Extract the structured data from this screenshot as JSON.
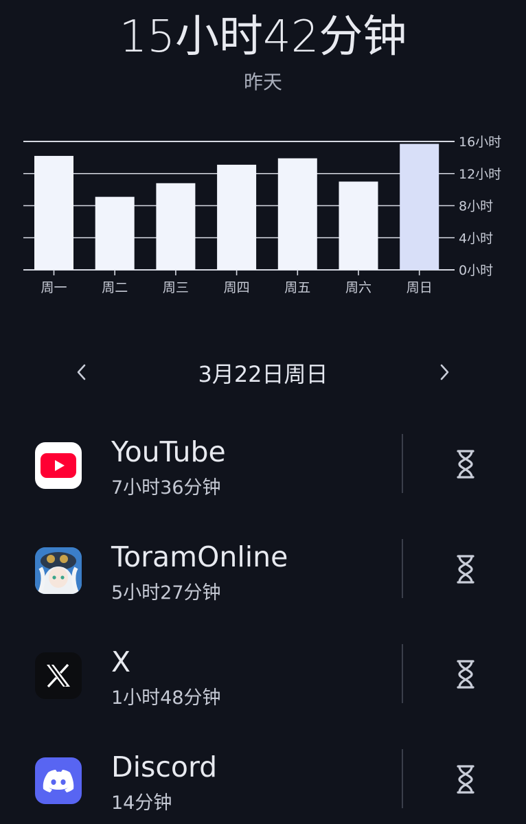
{
  "header": {
    "total_time": "15小时42分钟",
    "period_label": "昨天"
  },
  "chart_data": {
    "type": "bar",
    "categories": [
      "周一",
      "周二",
      "周三",
      "周四",
      "周五",
      "周六",
      "周日"
    ],
    "values": [
      14.2,
      9.1,
      10.8,
      13.1,
      13.9,
      11.0,
      15.7
    ],
    "ylim": [
      0,
      16
    ],
    "yticks": [
      "0小时",
      "4小时",
      "8小时",
      "12小时",
      "16小时"
    ],
    "ytick_values": [
      0,
      4,
      8,
      12,
      16
    ],
    "highlight_index": 6,
    "bar_color": "#f1f4fc",
    "highlight_color": "#d8dff8",
    "grid": true,
    "yaxis_position": "right"
  },
  "day_nav": {
    "prev_icon": "chevron-left-icon",
    "title": "3月22日周日",
    "next_icon": "chevron-right-icon"
  },
  "apps": [
    {
      "name": "YouTube",
      "time": "7小时36分钟",
      "icon": "youtube-icon",
      "timer_icon": "hourglass-icon"
    },
    {
      "name": "ToramOnline",
      "time": "5小时27分钟",
      "icon": "toram-online-icon",
      "timer_icon": "hourglass-icon"
    },
    {
      "name": "X",
      "time": "1小时48分钟",
      "icon": "x-icon",
      "timer_icon": "hourglass-icon"
    },
    {
      "name": "Discord",
      "time": "14分钟",
      "icon": "discord-icon",
      "timer_icon": "hourglass-icon"
    }
  ],
  "colors": {
    "background": "#10131c",
    "youtube_red": "#ff0033",
    "discord_blurple": "#5865f2"
  }
}
